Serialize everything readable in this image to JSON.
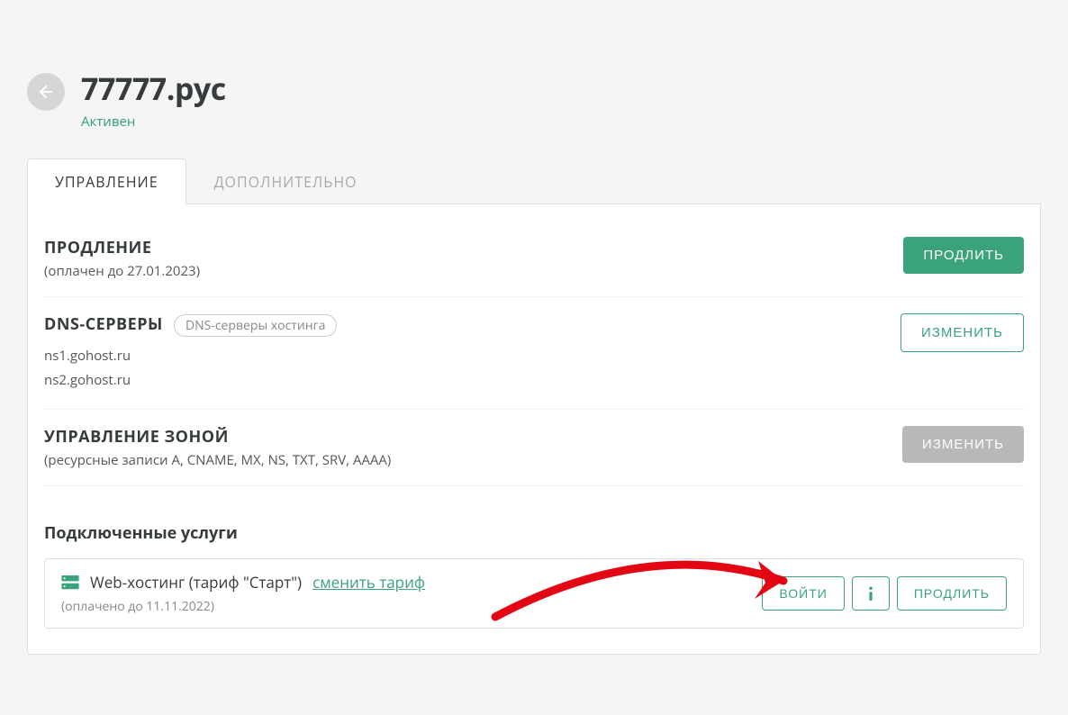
{
  "header": {
    "domain": "77777.рус",
    "status": "Активен"
  },
  "tabs": [
    {
      "label": "УПРАВЛЕНИЕ",
      "active": true
    },
    {
      "label": "ДОПОЛНИТЕЛЬНО",
      "active": false
    }
  ],
  "renewal": {
    "title": "ПРОДЛЕНИЕ",
    "paid_until": "(оплачен до 27.01.2023)",
    "action": "ПРОДЛИТЬ"
  },
  "dns": {
    "title": "DNS-СЕРВЕРЫ",
    "badge": "DNS-серверы хостинга",
    "servers": [
      "ns1.gohost.ru",
      "ns2.gohost.ru"
    ],
    "action": "ИЗМЕНИТЬ"
  },
  "zone": {
    "title": "УПРАВЛЕНИЕ ЗОНОЙ",
    "subtitle": "(ресурсные записи A, CNAME, MX, NS, TXT, SRV, AAAA)",
    "action": "ИЗМЕНИТЬ"
  },
  "connected": {
    "title": "Подключенные услуги",
    "service_name": "Web-хостинг (тариф \"Старт\")",
    "change_tariff": "сменить тариф",
    "paid_until": "(оплачено до  11.11.2022)",
    "login_action": "ВОЙТИ",
    "renew_action": "ПРОДЛИТЬ"
  }
}
